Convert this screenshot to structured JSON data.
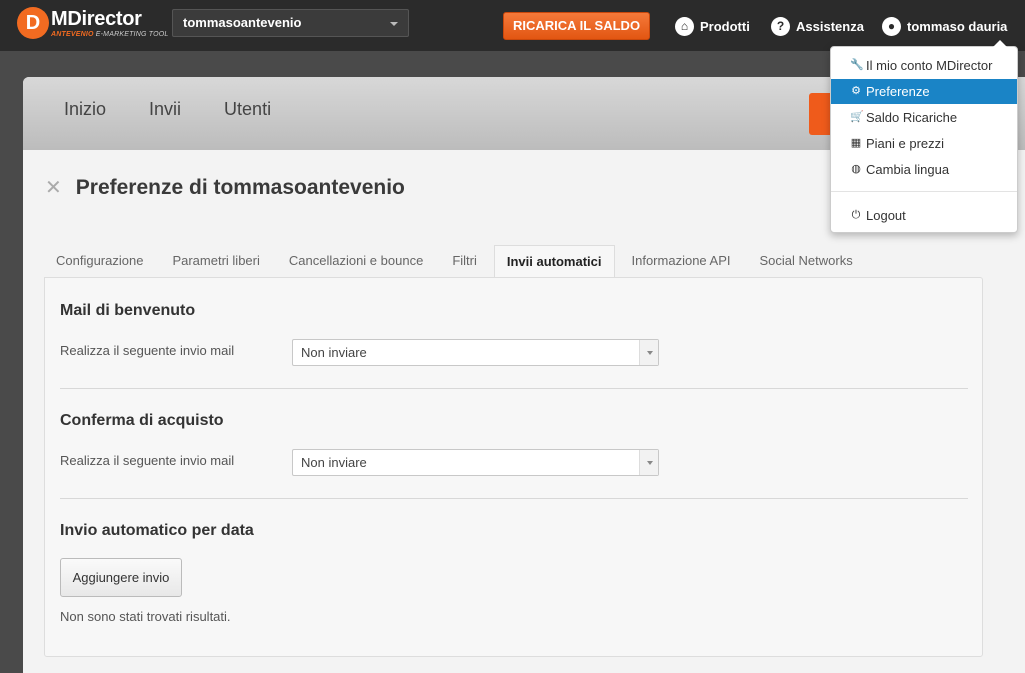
{
  "topbar": {
    "logo": {
      "letter": "D",
      "name": "MDirector",
      "tagline_brand": "ANTEVENIO",
      "tagline_rest": " E-MARKETING TOOL"
    },
    "account": "tommasoantevenio",
    "recharge_label": "RICARICA IL SALDO",
    "products_label": "Prodotti",
    "help_label": "Assistenza",
    "user_label": "tommaso dauria"
  },
  "user_menu": {
    "items": [
      {
        "icon": "wrench-icon",
        "label": "Il mio conto MDirector"
      },
      {
        "icon": "gear-icon",
        "label": "Preferenze",
        "active": true
      },
      {
        "icon": "cart-icon",
        "label": "Saldo Ricariche"
      },
      {
        "icon": "grid-icon",
        "label": "Piani e prezzi"
      },
      {
        "icon": "globe-icon",
        "label": "Cambia lingua"
      }
    ],
    "logout": "Logout"
  },
  "main_nav": [
    "Inizio",
    "Invii",
    "Utenti"
  ],
  "page": {
    "title": "Preferenze di tommasoantevenio",
    "tabs": [
      {
        "label": "Configurazione"
      },
      {
        "label": "Parametri liberi"
      },
      {
        "label": "Cancellazioni e bounce"
      },
      {
        "label": "Filtri"
      },
      {
        "label": "Invii automatici",
        "active": true
      },
      {
        "label": "Informazione API"
      },
      {
        "label": "Social Networks"
      }
    ],
    "sections": [
      {
        "title": "Mail di benvenuto",
        "field_label": "Realizza il seguente invio mail",
        "select_value": "Non inviare"
      },
      {
        "title": "Conferma di acquisto",
        "field_label": "Realizza il seguente invio mail",
        "select_value": "Non inviare"
      },
      {
        "title": "Invio automatico per data",
        "button_label": "Aggiungere invio",
        "empty_text": "Non sono stati trovati risultati."
      }
    ]
  }
}
